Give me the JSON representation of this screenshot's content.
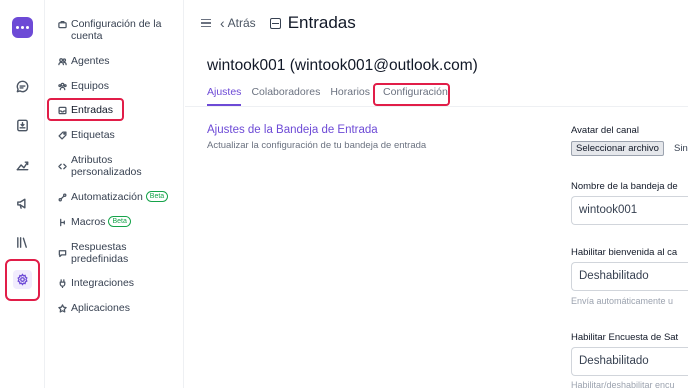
{
  "sidebar": {
    "items": [
      {
        "label": "Configuración de la cuenta",
        "icon": "briefcase-icon"
      },
      {
        "label": "Agentes",
        "icon": "people-icon"
      },
      {
        "label": "Equipos",
        "icon": "team-icon"
      },
      {
        "label": "Entradas",
        "icon": "inbox-icon"
      },
      {
        "label": "Etiquetas",
        "icon": "tag-icon"
      },
      {
        "label": "Atributos personalizados",
        "icon": "code-icon"
      },
      {
        "label": "Automatización",
        "icon": "automation-icon",
        "badge": "Beta"
      },
      {
        "label": "Macros",
        "icon": "macro-icon",
        "badge": "Beta"
      },
      {
        "label": "Respuestas predefinidas",
        "icon": "chat-icon"
      },
      {
        "label": "Integraciones",
        "icon": "plug-icon"
      },
      {
        "label": "Aplicaciones",
        "icon": "apps-icon"
      }
    ]
  },
  "header": {
    "back_label": "Atrás",
    "title": "Entradas"
  },
  "inbox": {
    "name": "wintook001 (wintook001@outlook.com)"
  },
  "tabs": [
    {
      "label": "Ajustes",
      "active": true
    },
    {
      "label": "Colaboradores",
      "active": false
    },
    {
      "label": "Horarios",
      "active": false
    },
    {
      "label": "Configuración",
      "active": false
    }
  ],
  "section": {
    "title": "Ajustes de la Bandeja de Entrada",
    "description": "Actualizar la configuración de tu bandeja de entrada"
  },
  "form": {
    "avatar_label": "Avatar del canal",
    "file_button": "Seleccionar archivo",
    "file_status": "Sin",
    "inbox_name_label": "Nombre de la bandeja de",
    "inbox_name_value": "wintook001",
    "welcome_label": "Habilitar bienvenida al ca",
    "welcome_value": "Deshabilitado",
    "welcome_help": "Envía automáticamente u",
    "survey_label": "Habilitar Encuesta de Sat",
    "survey_value": "Deshabilitado",
    "survey_help": "Habilitar/deshabilitar encu"
  },
  "colors": {
    "accent": "#6d4ad6",
    "highlight": "#e11d48"
  }
}
